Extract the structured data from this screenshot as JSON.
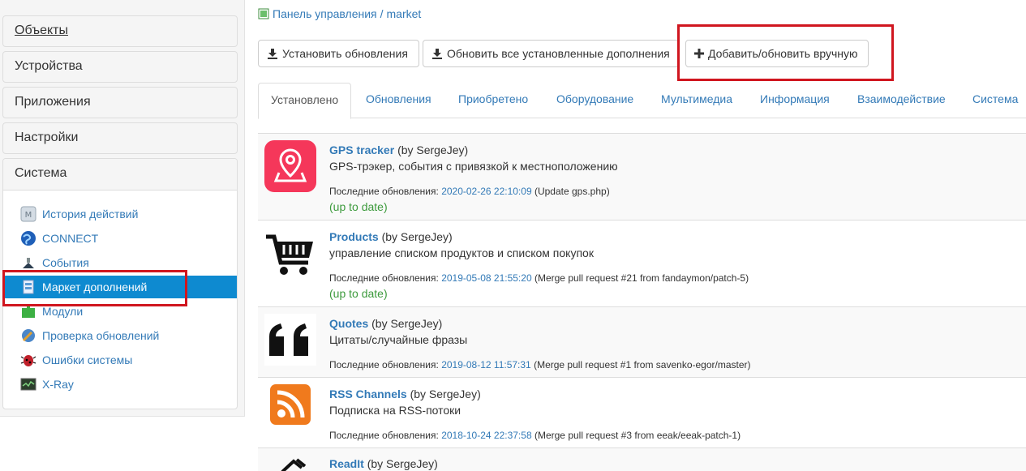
{
  "sidebar": {
    "objects": "Объекты",
    "devices": "Устройства",
    "apps": "Приложения",
    "settings": "Настройки",
    "system": "Система",
    "items": [
      {
        "label": "История действий",
        "icon": "history-icon"
      },
      {
        "label": "CONNECT",
        "icon": "globe-icon"
      },
      {
        "label": "События",
        "icon": "events-icon"
      },
      {
        "label": "Маркет дополнений",
        "icon": "market-icon",
        "active": true
      },
      {
        "label": "Модули",
        "icon": "puzzle-icon"
      },
      {
        "label": "Проверка обновлений",
        "icon": "update-check-icon"
      },
      {
        "label": "Ошибки системы",
        "icon": "bug-icon"
      },
      {
        "label": "X-Ray",
        "icon": "xray-icon"
      }
    ]
  },
  "breadcrumb": {
    "root": "Панель управления",
    "separator": "/",
    "current": "market"
  },
  "toolbar": {
    "install_updates": "Установить обновления",
    "update_all": "Обновить все установленные дополнения",
    "add_manual": "Добавить/обновить вручную"
  },
  "tabs": [
    "Установлено",
    "Обновления",
    "Приобретено",
    "Оборудование",
    "Мультимедиа",
    "Информация",
    "Взаимодействие",
    "Система"
  ],
  "plugins": [
    {
      "name": "GPS tracker",
      "by": "(by SergeJey)",
      "desc": "GPS-трэкер, события с привязкой к местноположению",
      "upd_label": "Последние обновления:",
      "date": "2020-02-26 22:10:09",
      "note": "(Update gps.php)",
      "status": "(up to date)",
      "icon": "map-pin-icon"
    },
    {
      "name": "Products",
      "by": "(by SergeJey)",
      "desc": "управление списком продуктов и списком покупок",
      "upd_label": "Последние обновления:",
      "date": "2019-05-08 21:55:20",
      "note": "(Merge pull request #21 from fandaymon/patch-5)",
      "status": "(up to date)",
      "icon": "shopping-cart-icon"
    },
    {
      "name": "Quotes",
      "by": "(by SergeJey)",
      "desc": "Цитаты/случайные фразы",
      "upd_label": "Последние обновления:",
      "date": "2019-08-12 11:57:31",
      "note": "(Merge pull request #1 from savenko-egor/master)",
      "icon": "quote-icon"
    },
    {
      "name": "RSS Channels",
      "by": "(by SergeJey)",
      "desc": "Подписка на RSS-потоки",
      "upd_label": "Последние обновления:",
      "date": "2018-10-24 22:37:58",
      "note": "(Merge pull request #3 from eeak/eeak-patch-1)",
      "icon": "rss-icon"
    },
    {
      "name": "ReadIt",
      "by": "(by SergeJey)",
      "icon": "readit-icon"
    }
  ],
  "colors": {
    "link": "#337ab7",
    "active_menu": "#0e8ad0",
    "highlight": "#d0161f",
    "ok": "#3c9a3c"
  }
}
